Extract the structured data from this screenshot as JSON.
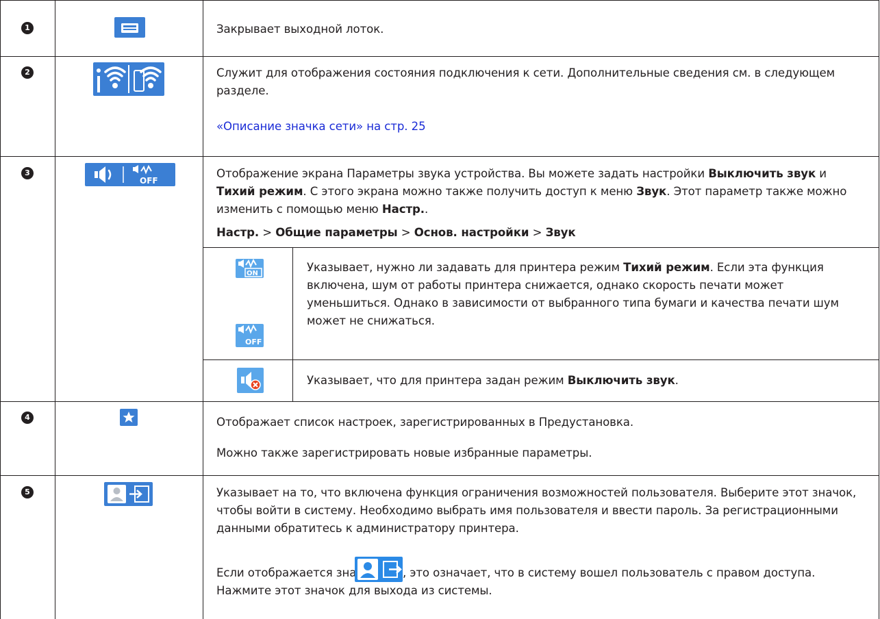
{
  "rows": [
    {
      "number": "1",
      "icon": "output-tray-icon",
      "desc": "Закрывает выходной лоток."
    },
    {
      "number": "2",
      "icon": "wifi-status-icon",
      "desc": "Служит для отображения состояния подключения к сети. Дополнительные сведения см. в следующем разделе.",
      "link": "«Описание значка сети» на стр. 25"
    },
    {
      "number": "3",
      "icon": "sound-icon",
      "desc_parts": [
        "Отображение экрана Параметры звука устройства. Вы можете задать настройки ",
        "Выключить звук",
        " и ",
        "Тихий режим",
        ". С этого экрана можно также получить доступ к меню ",
        "Звук",
        ". Этот параметр также можно изменить с помощью меню ",
        "Настр.",
        "."
      ],
      "path": [
        "Настр.",
        " > ",
        "Общие параметры",
        " > ",
        "Основ. настройки",
        " > ",
        "Звук"
      ],
      "sub": [
        {
          "icons": [
            "quiet-mode-on-icon",
            "quiet-mode-off-icon"
          ],
          "desc_parts": [
            "Указывает, нужно ли задавать для принтера режим ",
            "Тихий режим",
            ". Если эта функция включена, шум от работы принтера снижается, однако скорость печати может уменьшиться. Однако в зависимости от выбранного типа бумаги и качества печати шум может не снижаться."
          ]
        },
        {
          "icons": [
            "mute-icon"
          ],
          "desc_parts": [
            "Указывает, что для принтера задан режим ",
            "Выключить звук",
            "."
          ]
        }
      ]
    },
    {
      "number": "4",
      "icon": "star-preset-icon",
      "desc": "Отображает список настроек, зарегистрированных в Предустановка.",
      "desc2": "Можно также зарегистрировать новые избранные параметры."
    },
    {
      "number": "5",
      "icon": "user-login-icon",
      "desc": "Указывает на то, что включена функция ограничения возможностей пользователя. Выберите этот значок, чтобы войти в систему. Необходимо выбрать имя пользователя и ввести пароль. За регистрационными данными обратитесь к администратору принтера.",
      "desc2_before": "Если отображается значок",
      "desc2_after": ", это означает, что в систему вошел пользователь с правом доступа. Нажмите этот значок для выхода из системы."
    }
  ],
  "colors": {
    "icon_blue": "#3b7fd4",
    "link": "#1a2bd6",
    "text": "#231f20"
  }
}
